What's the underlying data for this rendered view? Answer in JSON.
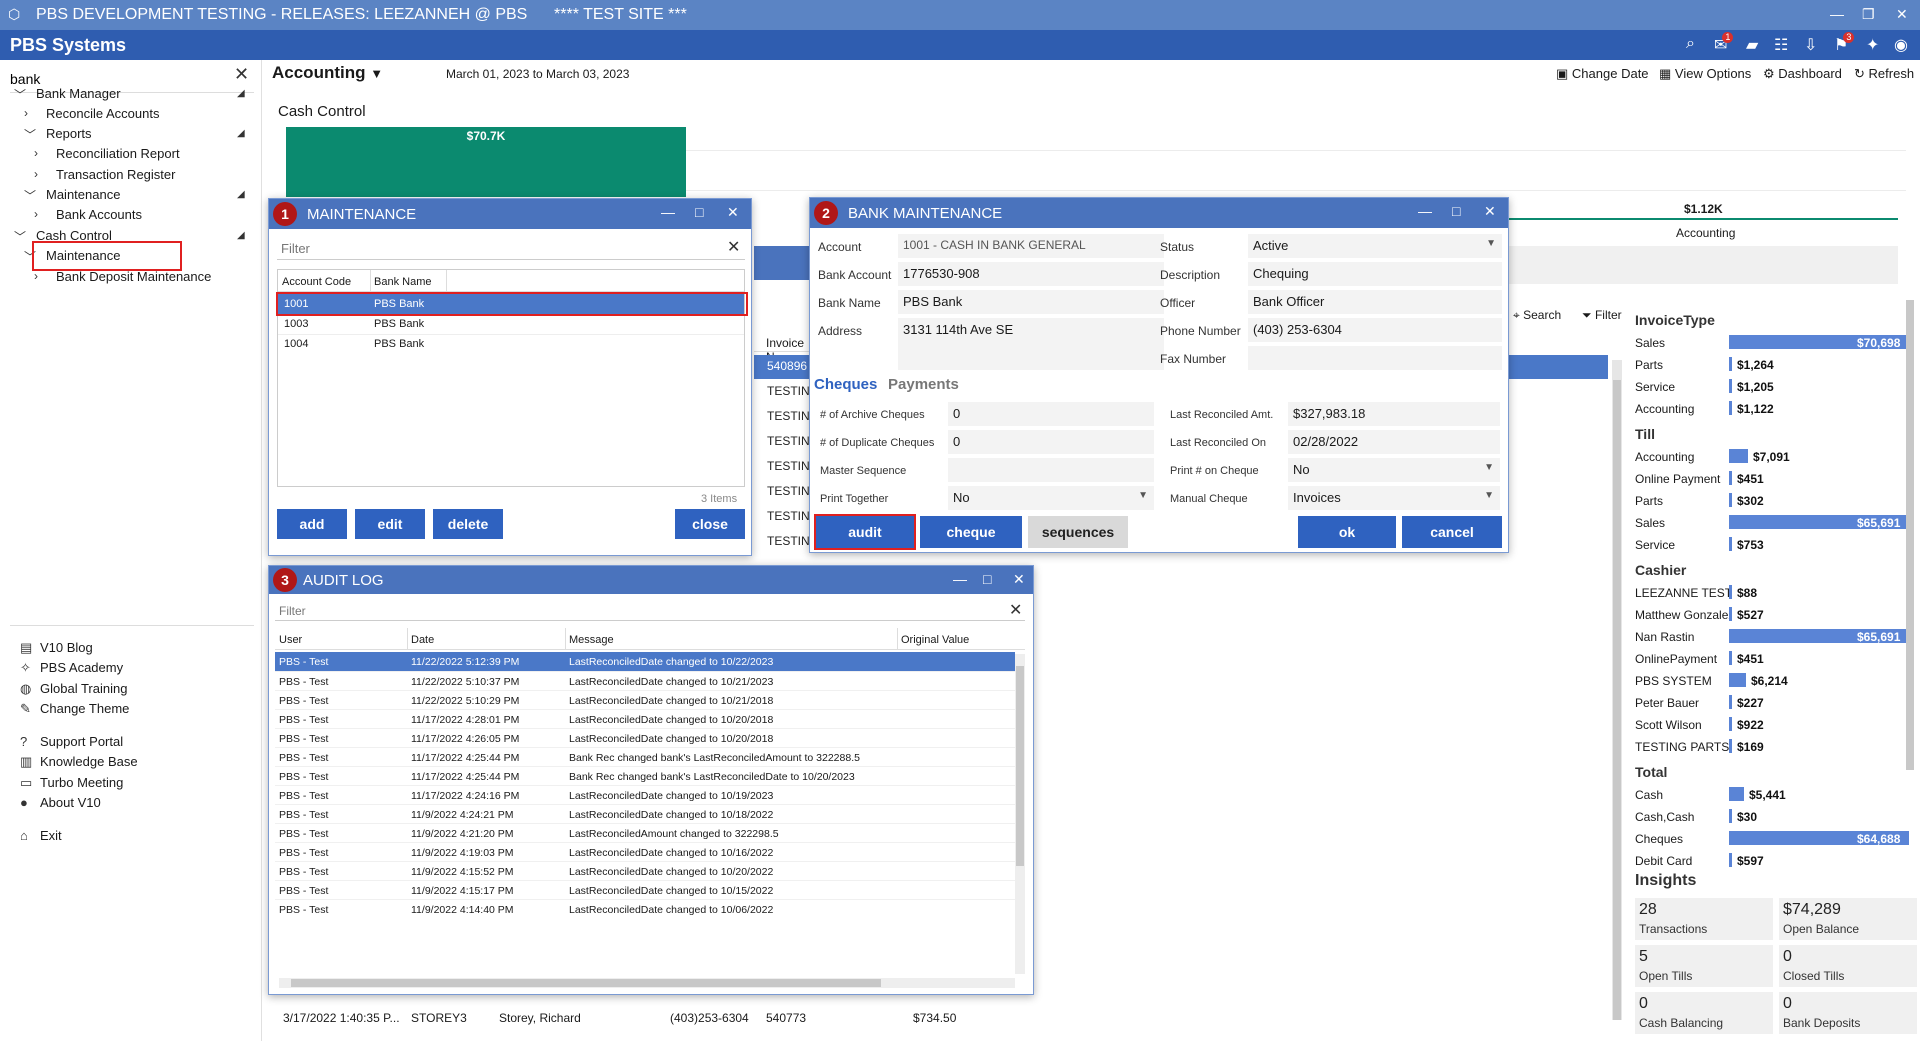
{
  "window": {
    "title": "PBS DEVELOPMENT TESTING - RELEASES: LEEZANNEH @ PBS      **** TEST SITE ***"
  },
  "app": {
    "brand": "PBS Systems",
    "mail_badge": "1",
    "flag_badge": "3"
  },
  "sidebar": {
    "search_value": "bank",
    "tree": [
      {
        "label": "Bank Manager",
        "level": 0
      },
      {
        "label": "Reconcile Accounts",
        "level": 1
      },
      {
        "label": "Reports",
        "level": 1
      },
      {
        "label": "Reconciliation Report",
        "level": 2
      },
      {
        "label": "Transaction Register",
        "level": 2
      },
      {
        "label": "Maintenance",
        "level": 1
      },
      {
        "label": "Bank Accounts",
        "level": 2
      },
      {
        "label": "Cash Control",
        "level": 0
      },
      {
        "label": "Maintenance",
        "level": 1
      },
      {
        "label": "Bank Deposit Maintenance",
        "level": 2
      }
    ],
    "bottom": [
      "V10 Blog",
      "PBS Academy",
      "Global Training",
      "Change Theme",
      "Support Portal",
      "Knowledge Base",
      "Turbo Meeting",
      "About V10",
      "Exit"
    ]
  },
  "header": {
    "module": "Accounting",
    "daterange": "March 01, 2023 to March 03, 2023",
    "change_date": "Change Date",
    "view_options": "View Options",
    "dashboard": "Dashboard",
    "refresh": "Refresh"
  },
  "cash_control": {
    "title": "Cash Control",
    "bar_label": "$70.7K",
    "acct_value": "$1.12K",
    "acct_label": "Accounting"
  },
  "maintenance": {
    "num": "1",
    "title": "MAINTENANCE",
    "filter": "Filter",
    "col_code": "Account Code",
    "col_bank": "Bank Name",
    "rows": [
      {
        "code": "1001",
        "bank": "PBS Bank"
      },
      {
        "code": "1003",
        "bank": "PBS Bank"
      },
      {
        "code": "1004",
        "bank": "PBS Bank"
      }
    ],
    "count": "3 Items",
    "add": "add",
    "edit": "edit",
    "delete": "delete",
    "close": "close"
  },
  "bank_maint": {
    "num": "2",
    "title": "BANK MAINTENANCE",
    "account_lbl": "Account",
    "account": "1001 - CASH IN BANK GENERAL",
    "bank_account_lbl": "Bank Account",
    "bank_account": "1776530-908",
    "bank_name_lbl": "Bank Name",
    "bank_name": "PBS Bank",
    "address_lbl": "Address",
    "address": "3131 114th Ave SE",
    "status_lbl": "Status",
    "status": "Active",
    "desc_lbl": "Description",
    "desc": "Chequing",
    "officer_lbl": "Officer",
    "officer": "Bank Officer",
    "phone_lbl": "Phone Number",
    "phone": "(403) 253-6304",
    "fax_lbl": "Fax Number",
    "fax": "",
    "tab_cheques": "Cheques",
    "tab_payments": "Payments",
    "archive_lbl": "# of Archive Cheques",
    "archive": "0",
    "dup_lbl": "# of Duplicate Cheques",
    "dup": "0",
    "master_lbl": "Master Sequence",
    "master": "",
    "print_together_lbl": "Print Together",
    "print_together": "No",
    "last_amt_lbl": "Last Reconciled Amt.",
    "last_amt": "$327,983.18",
    "last_on_lbl": "Last Reconciled On",
    "last_on": "02/28/2022",
    "print_num_lbl": "Print # on Cheque",
    "print_num": "No",
    "manual_lbl": "Manual Cheque",
    "manual": "Invoices",
    "audit": "audit",
    "cheque": "cheque",
    "sequences": "sequences",
    "ok": "ok",
    "cancel": "cancel"
  },
  "audit_log": {
    "num": "3",
    "title": "AUDIT LOG",
    "filter": "Filter",
    "cols": [
      "User",
      "Date",
      "Message",
      "Original Value"
    ],
    "rows": [
      [
        "PBS - Test",
        "11/22/2022 5:12:39 PM",
        "LastReconciledDate changed to 10/22/2023"
      ],
      [
        "PBS - Test",
        "11/22/2022 5:10:37 PM",
        "LastReconciledDate changed to 10/21/2023"
      ],
      [
        "PBS - Test",
        "11/22/2022 5:10:29 PM",
        "LastReconciledDate changed to 10/21/2018"
      ],
      [
        "PBS - Test",
        "11/17/2022 4:28:01 PM",
        "LastReconciledDate changed to 10/20/2018"
      ],
      [
        "PBS - Test",
        "11/17/2022 4:26:05 PM",
        "LastReconciledDate changed to 10/20/2018"
      ],
      [
        "PBS - Test",
        "11/17/2022 4:25:44 PM",
        "Bank Rec changed bank's LastReconciledAmount to 322288.5"
      ],
      [
        "PBS - Test",
        "11/17/2022 4:25:44 PM",
        "Bank Rec changed bank's LastReconciledDate to 10/20/2023"
      ],
      [
        "PBS - Test",
        "11/17/2022 4:24:16 PM",
        "LastReconciledDate changed to 10/19/2023"
      ],
      [
        "PBS - Test",
        "11/9/2022 4:24:21 PM",
        "LastReconciledDate changed to 10/18/2022"
      ],
      [
        "PBS - Test",
        "11/9/2022 4:21:20 PM",
        "LastReconciledAmount changed to 322298.5"
      ],
      [
        "PBS - Test",
        "11/9/2022 4:19:03 PM",
        "LastReconciledDate changed to 10/16/2022"
      ],
      [
        "PBS - Test",
        "11/9/2022 4:15:52 PM",
        "LastReconciledDate changed to 10/20/2022"
      ],
      [
        "PBS - Test",
        "11/9/2022 4:15:17 PM",
        "LastReconciledDate changed to 10/15/2022"
      ],
      [
        "PBS - Test",
        "11/9/2022 4:14:40 PM",
        "LastReconciledDate changed to 10/06/2022"
      ]
    ]
  },
  "bg_table": {
    "col_invoice": "Invoice N",
    "rows": [
      "540896",
      "TESTING",
      "TESTING",
      "TESTING",
      "TESTING",
      "TESTING",
      "TESTING",
      "TESTING"
    ],
    "bottom_row": [
      "3/17/2022 1:40:35 P...",
      "STOREY3",
      "Storey, Richard",
      "(403)253-6304",
      "540773",
      "$734.50"
    ],
    "search": "Search",
    "filter": "Filter"
  },
  "right_panel": {
    "groups": [
      {
        "title": "InvoiceType",
        "items": [
          {
            "label": "Sales",
            "value": "$70,698",
            "frac": 1.0
          },
          {
            "label": "Parts",
            "value": "$1,264",
            "frac": 0.018
          },
          {
            "label": "Service",
            "value": "$1,205",
            "frac": 0.017
          },
          {
            "label": "Accounting",
            "value": "$1,122",
            "frac": 0.016
          }
        ]
      },
      {
        "title": "Till",
        "items": [
          {
            "label": "Accounting",
            "value": "$7,091",
            "frac": 0.108
          },
          {
            "label": "Online Payment",
            "value": "$451",
            "frac": 0.007
          },
          {
            "label": "Parts",
            "value": "$302",
            "frac": 0.005
          },
          {
            "label": "Sales",
            "value": "$65,691",
            "frac": 1.0
          },
          {
            "label": "Service",
            "value": "$753",
            "frac": 0.011
          }
        ]
      },
      {
        "title": "Cashier",
        "items": [
          {
            "label": "LEEZANNE  TEST",
            "value": "$88",
            "frac": 0.001
          },
          {
            "label": "Matthew Gonzalez",
            "value": "$527",
            "frac": 0.008
          },
          {
            "label": "Nan Rastin",
            "value": "$65,691",
            "frac": 1.0
          },
          {
            "label": "OnlinePayment",
            "value": "$451",
            "frac": 0.007
          },
          {
            "label": "PBS SYSTEM",
            "value": "$6,214",
            "frac": 0.095
          },
          {
            "label": "Peter Bauer",
            "value": "$227",
            "frac": 0.003
          },
          {
            "label": "Scott Wilson",
            "value": "$922",
            "frac": 0.014
          },
          {
            "label": "TESTING PARTS",
            "value": "$169",
            "frac": 0.003
          }
        ]
      },
      {
        "title": "Total",
        "items": [
          {
            "label": "Cash",
            "value": "$5,441",
            "frac": 0.084
          },
          {
            "label": "Cash,Cash",
            "value": "$30",
            "frac": 0.0005
          },
          {
            "label": "Cheques",
            "value": "$64,688",
            "frac": 1.0
          },
          {
            "label": "Debit Card",
            "value": "$597",
            "frac": 0.009
          }
        ]
      }
    ],
    "insights_title": "Insights",
    "insights": [
      {
        "value": "28",
        "label": "Transactions"
      },
      {
        "value": "$74,289",
        "label": "Open Balance"
      },
      {
        "value": "5",
        "label": "Open Tills"
      },
      {
        "value": "0",
        "label": "Closed Tills"
      },
      {
        "value": "0",
        "label": "Cash Balancing"
      },
      {
        "value": "0",
        "label": "Bank Deposits"
      }
    ]
  },
  "colors": {
    "titlebar": "#5b84c4",
    "appbar": "#2f5db0",
    "accent": "#2f62c0",
    "bar": "#5a84d6",
    "green": "#0b8a6f",
    "highlight": "#e02020"
  }
}
